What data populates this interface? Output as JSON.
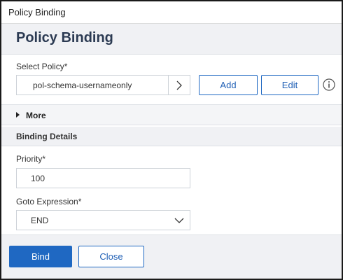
{
  "window": {
    "title": "Policy Binding"
  },
  "header": {
    "title": "Policy Binding"
  },
  "select_policy": {
    "label": "Select Policy*",
    "value": "pol-schema-usernameonly",
    "add_label": "Add",
    "edit_label": "Edit"
  },
  "more": {
    "label": "More"
  },
  "binding_details": {
    "heading": "Binding Details",
    "priority": {
      "label": "Priority*",
      "value": "100"
    },
    "goto_expression": {
      "label": "Goto Expression*",
      "value": "END"
    }
  },
  "footer": {
    "bind_label": "Bind",
    "close_label": "Close"
  },
  "colors": {
    "accent": "#1f68c2",
    "header_bg": "#f0f1f4",
    "title_text": "#2b3a52"
  },
  "icons": [
    "chevron-right-icon",
    "info-icon",
    "caret-right-icon",
    "chevron-down-icon"
  ]
}
